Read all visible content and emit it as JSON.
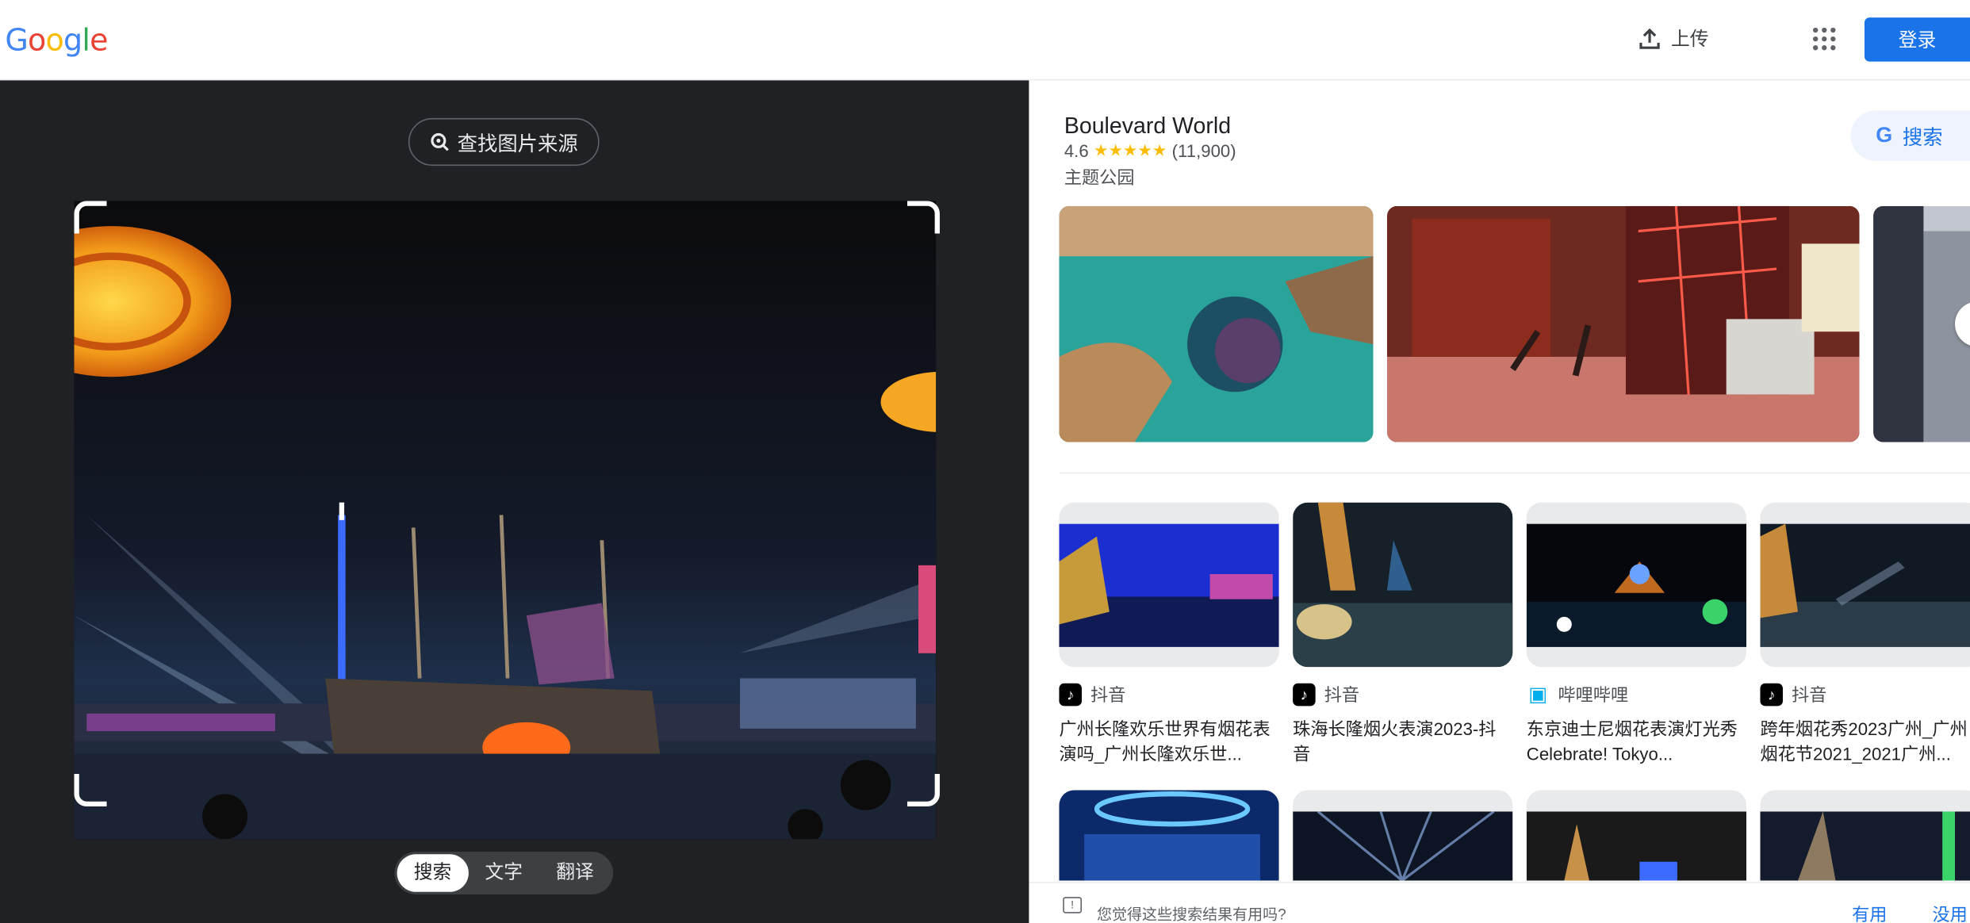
{
  "header": {
    "logo_letters": [
      {
        "ch": "G",
        "color": "#4285f4"
      },
      {
        "ch": "o",
        "color": "#ea4335"
      },
      {
        "ch": "o",
        "color": "#fbbc05"
      },
      {
        "ch": "g",
        "color": "#4285f4"
      },
      {
        "ch": "l",
        "color": "#34a853"
      },
      {
        "ch": "e",
        "color": "#ea4335"
      }
    ],
    "upload_label": "上传",
    "apps_icon": "apps-grid-icon",
    "login_label": "登录"
  },
  "lens": {
    "find_source_label": "查找图片来源",
    "modes": [
      "搜索",
      "文字",
      "翻译"
    ],
    "active_mode": "搜索"
  },
  "knowledge_panel": {
    "title": "Boulevard World",
    "rating": "4.6",
    "stars": "★★★★★",
    "review_count": "(11,900)",
    "type": "主题公园",
    "google_search_label": "搜索"
  },
  "results": [
    {
      "source": "抖音",
      "source_icon": "tiktok-icon",
      "title": "广州长隆欢乐世界有烟花表演吗_广州长隆欢乐世..."
    },
    {
      "source": "抖音",
      "source_icon": "tiktok-icon",
      "title": "珠海长隆烟火表演2023-抖音"
    },
    {
      "source": "哔哩哔哩",
      "source_icon": "bilibili-icon",
      "title": "东京迪士尼烟花表演灯光秀Celebrate! Tokyo..."
    },
    {
      "source": "抖音",
      "source_icon": "tiktok-icon",
      "title": "跨年烟花秀2023广州_广州烟花节2021_2021广州..."
    }
  ],
  "feedback": {
    "question": "您觉得这些搜索结果有用吗?",
    "yes": "有用",
    "no": "没用"
  },
  "colors": {
    "accent": "#1a73e8",
    "dark_panel": "#202124"
  }
}
